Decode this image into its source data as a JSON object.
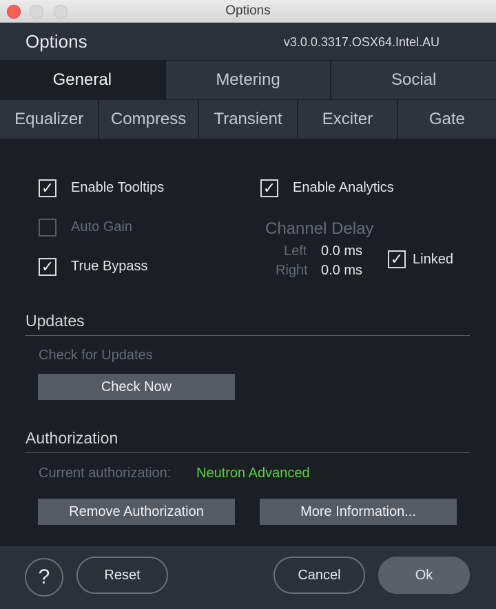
{
  "window": {
    "title": "Options"
  },
  "header": {
    "title": "Options",
    "version": "v3.0.0.3317.OSX64.Intel.AU"
  },
  "tabs_primary": [
    {
      "label": "General",
      "active": true
    },
    {
      "label": "Metering",
      "active": false
    },
    {
      "label": "Social",
      "active": false
    }
  ],
  "tabs_secondary": [
    {
      "label": "Equalizer"
    },
    {
      "label": "Compress"
    },
    {
      "label": "Transient"
    },
    {
      "label": "Exciter"
    },
    {
      "label": "Gate"
    }
  ],
  "general": {
    "enable_tooltips": {
      "label": "Enable Tooltips",
      "checked": true
    },
    "enable_analytics": {
      "label": "Enable Analytics",
      "checked": true
    },
    "auto_gain": {
      "label": "Auto Gain",
      "checked": false,
      "disabled": true
    },
    "true_bypass": {
      "label": "True Bypass",
      "checked": true
    },
    "channel_delay": {
      "title": "Channel Delay",
      "left_label": "Left",
      "left_value": "0.0 ms",
      "right_label": "Right",
      "right_value": "0.0 ms",
      "linked_label": "Linked",
      "linked_checked": true
    }
  },
  "updates": {
    "title": "Updates",
    "check_label": "Check for Updates",
    "check_now_button": "Check Now"
  },
  "authorization": {
    "title": "Authorization",
    "current_label": "Current authorization:",
    "current_value": "Neutron Advanced",
    "remove_button": "Remove Authorization",
    "more_info_button": "More Information..."
  },
  "footer": {
    "help_glyph": "?",
    "reset_button": "Reset",
    "cancel_button": "Cancel",
    "ok_button": "Ok"
  },
  "colors": {
    "accent_green": "#5dd13d",
    "background": "#1b1e24",
    "panel": "#2c3038"
  }
}
